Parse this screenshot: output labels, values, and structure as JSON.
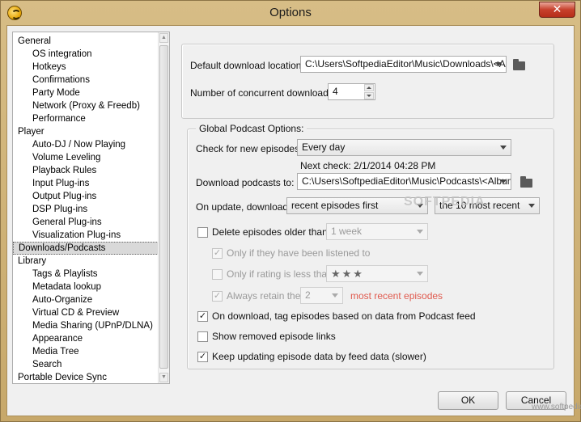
{
  "window": {
    "title": "Options",
    "close_label": "✕"
  },
  "tree": {
    "items": [
      {
        "label": "General",
        "level": 0
      },
      {
        "label": "OS integration",
        "level": 1
      },
      {
        "label": "Hotkeys",
        "level": 1
      },
      {
        "label": "Confirmations",
        "level": 1
      },
      {
        "label": "Party Mode",
        "level": 1
      },
      {
        "label": "Network (Proxy & Freedb)",
        "level": 1
      },
      {
        "label": "Performance",
        "level": 1
      },
      {
        "label": "Player",
        "level": 0
      },
      {
        "label": "Auto-DJ / Now Playing",
        "level": 1
      },
      {
        "label": "Volume Leveling",
        "level": 1
      },
      {
        "label": "Playback Rules",
        "level": 1
      },
      {
        "label": "Input Plug-ins",
        "level": 1
      },
      {
        "label": "Output Plug-ins",
        "level": 1
      },
      {
        "label": "DSP Plug-ins",
        "level": 1
      },
      {
        "label": "General Plug-ins",
        "level": 1
      },
      {
        "label": "Visualization Plug-ins",
        "level": 1
      },
      {
        "label": "Downloads/Podcasts",
        "level": 0,
        "selected": true
      },
      {
        "label": "Library",
        "level": 0
      },
      {
        "label": "Tags & Playlists",
        "level": 1
      },
      {
        "label": "Metadata lookup",
        "level": 1
      },
      {
        "label": "Auto-Organize",
        "level": 1
      },
      {
        "label": "Virtual CD & Preview",
        "level": 1
      },
      {
        "label": "Media Sharing (UPnP/DLNA)",
        "level": 1
      },
      {
        "label": "Appearance",
        "level": 1
      },
      {
        "label": "Media Tree",
        "level": 1
      },
      {
        "label": "Search",
        "level": 1
      },
      {
        "label": "Portable Device Sync",
        "level": 0
      }
    ]
  },
  "downloads": {
    "location_label": "Default download location:",
    "location_value": "C:\\Users\\SoftpediaEditor\\Music\\Downloads\\<Ar",
    "concurrent_label": "Number of concurrent downloads:",
    "concurrent_value": "4"
  },
  "podcast": {
    "group_title": "Global Podcast Options:",
    "check_label": "Check for new episodes:",
    "check_value": "Every day",
    "next_check": "Next check: 2/1/2014 04:28 PM",
    "download_to_label": "Download podcasts to:",
    "download_to_value": "C:\\Users\\SoftpediaEditor\\Music\\Podcasts\\<Album",
    "on_update_label": "On update, download",
    "on_update_value": "recent episodes first",
    "recent_count_value": "the 10 most recent",
    "delete_label": "Delete episodes older than",
    "delete_value": "1 week",
    "listened_label": "Only if they have been listened to",
    "rating_label": "Only if rating is less than",
    "rating_stars": "★★★",
    "retain_label": "Always retain the",
    "retain_value": "2",
    "retain_suffix": "most recent episodes",
    "tag_label": "On download, tag episodes based on data from Podcast feed",
    "removed_label": "Show removed episode links",
    "keep_updating_label": "Keep updating episode data by feed data (slower)",
    "checkmark": "✓"
  },
  "buttons": {
    "ok": "OK",
    "cancel": "Cancel"
  },
  "watermark": {
    "big": "SOFTPEDIA",
    "small": "www.softpedia.com"
  }
}
